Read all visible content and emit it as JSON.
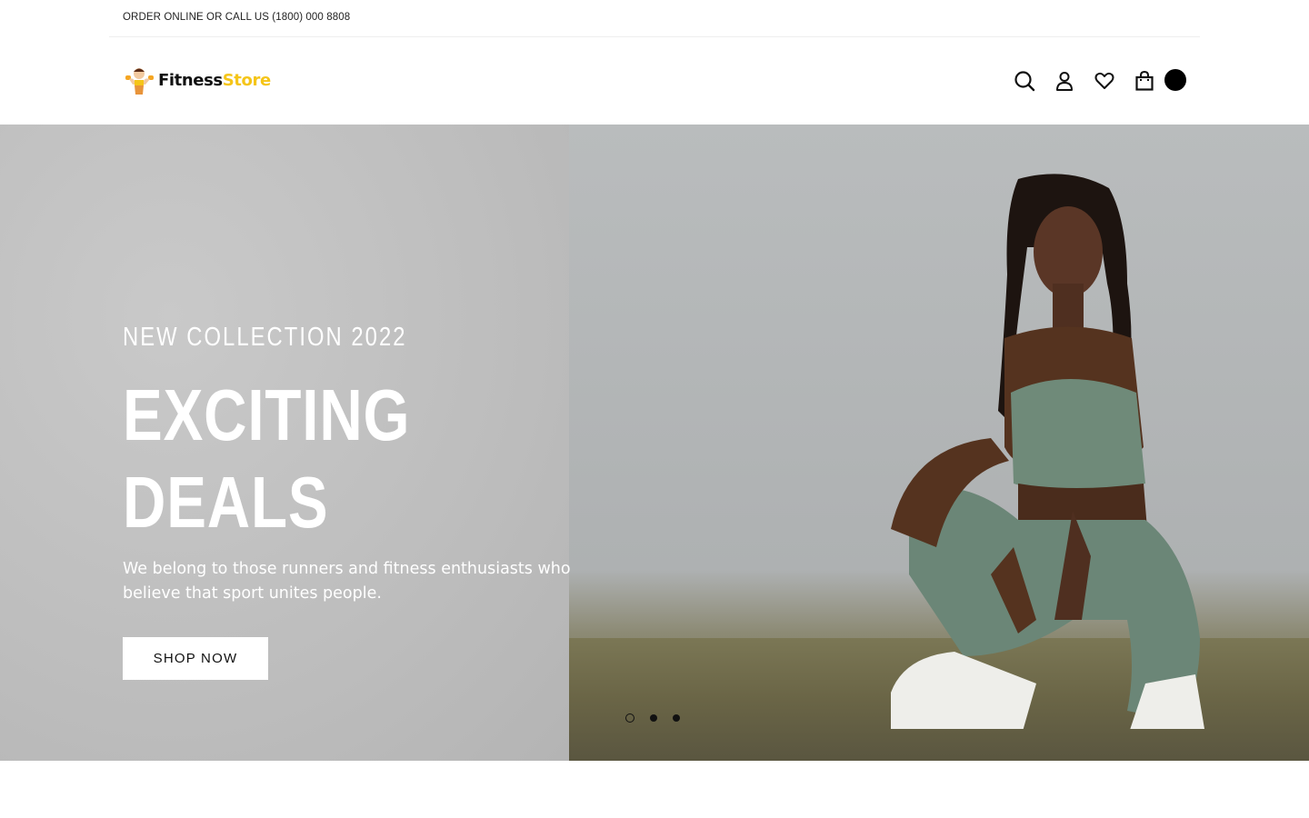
{
  "topbar": {
    "text": "ORDER ONLINE OR CALL US (1800) 000 8808"
  },
  "header": {
    "logo": {
      "word1": "Fitness",
      "word2": "Store"
    },
    "icons": [
      "search-icon",
      "account-icon",
      "wishlist-icon",
      "cart-icon"
    ],
    "cart_count": ""
  },
  "hero": {
    "subtitle": "NEW COLLECTION 2022",
    "title_line1": "EXCITING",
    "title_line2": "DEALS",
    "description": "We belong to those runners and fitness enthusiasts who believe that sport unites people.",
    "cta_label": "SHOP NOW",
    "slides": {
      "count": 3,
      "active": 1
    }
  },
  "colors": {
    "accent": "#f5c518",
    "text": "#111111",
    "hero_text": "#ffffff"
  }
}
